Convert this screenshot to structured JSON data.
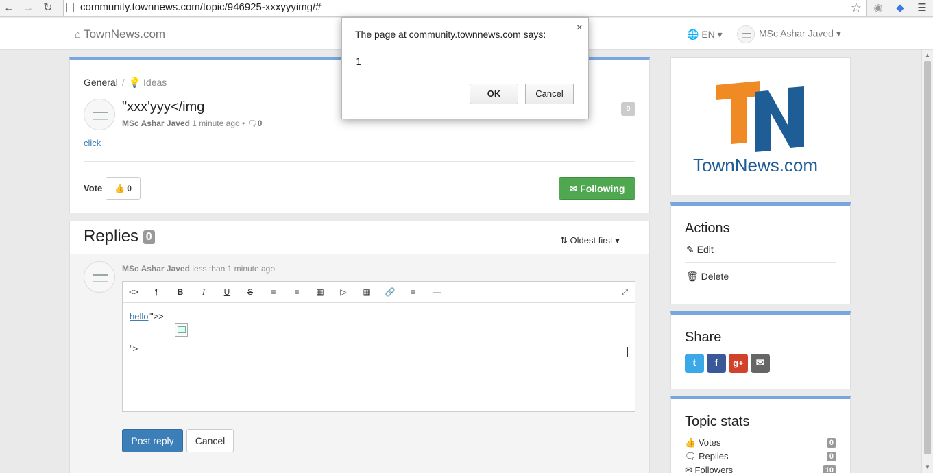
{
  "browser": {
    "url": "community.townnews.com/topic/946925-xxxyyyimg/#",
    "back_icon": "arrow-left-icon",
    "forward_icon": "arrow-right-icon",
    "reload_icon": "reload-icon",
    "star_icon": "star-icon",
    "menu_icon": "hamburger-menu-icon"
  },
  "navbar": {
    "brand": "TownNews.com",
    "language": "EN",
    "user": "MSc Ashar Javed"
  },
  "topic": {
    "breadcrumb": [
      "General",
      "Ideas"
    ],
    "title": "\"xxx'yyy</img",
    "author": "MSc Ashar Javed",
    "time": "1 minute ago",
    "comment_count": "0",
    "link_text": "click",
    "vote_count": "0",
    "vote_label": "Vote",
    "vote_button_count": "0",
    "following_label": "Following"
  },
  "replies": {
    "title": "Replies",
    "count": "0",
    "sort_label": "Oldest first",
    "reply_author": "MSc Ashar Javed",
    "reply_time": "less than 1 minute ago",
    "editor_line1_link": "hello",
    "editor_line1_rest": "'\">>",
    "editor_line3": "\">",
    "post_button": "Post reply",
    "cancel_button": "Cancel"
  },
  "sidebar": {
    "logo_text": "TownNews.com",
    "actions_title": "Actions",
    "edit_label": "Edit",
    "delete_label": "Delete",
    "share_title": "Share",
    "share_icons": [
      "twitter-icon",
      "facebook-icon",
      "google-plus-icon",
      "email-icon"
    ],
    "stats_title": "Topic stats",
    "stats": [
      {
        "label": "Votes",
        "value": "0"
      },
      {
        "label": "Replies",
        "value": "0"
      },
      {
        "label": "Followers",
        "value": "10"
      }
    ]
  },
  "dialog": {
    "title": "The page at community.townnews.com says:",
    "message": "1",
    "ok_label": "OK",
    "cancel_label": "Cancel"
  },
  "colors": {
    "accent": "#7aa6e0",
    "following_green": "#4fa84f",
    "post_blue": "#3c7fb8",
    "logo_orange": "#f08a24",
    "logo_blue": "#1f5d96"
  }
}
